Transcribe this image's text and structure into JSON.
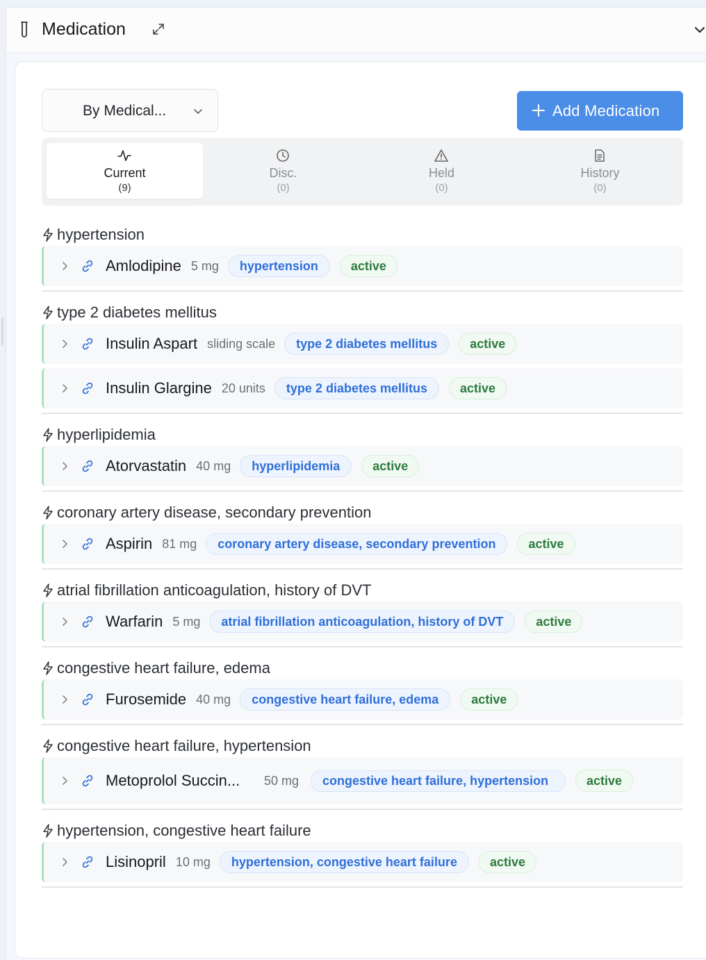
{
  "section": {
    "title": "Medication"
  },
  "filter": {
    "selected": "By Medical..."
  },
  "add_button": {
    "label": "Add Medication"
  },
  "tabs": [
    {
      "label": "Current",
      "count": "(9)",
      "icon": "activity-icon",
      "active": true
    },
    {
      "label": "Disc.",
      "count": "(0)",
      "icon": "clock-icon",
      "active": false
    },
    {
      "label": "Held",
      "count": "(0)",
      "icon": "warning-triangle-icon",
      "active": false
    },
    {
      "label": "History",
      "count": "(0)",
      "icon": "document-icon",
      "active": false
    }
  ],
  "groups": [
    {
      "condition": "hypertension",
      "meds": [
        {
          "name": "Amlodipine",
          "dose": "5 mg",
          "indication": "hypertension",
          "status": "active"
        }
      ]
    },
    {
      "condition": "type 2 diabetes mellitus",
      "meds": [
        {
          "name": "Insulin Aspart",
          "dose": "sliding scale",
          "indication": "type 2 diabetes mellitus",
          "status": "active"
        },
        {
          "name": "Insulin Glargine",
          "dose": "20 units",
          "indication": "type 2 diabetes mellitus",
          "status": "active"
        }
      ]
    },
    {
      "condition": "hyperlipidemia",
      "meds": [
        {
          "name": "Atorvastatin",
          "dose": "40 mg",
          "indication": "hyperlipidemia",
          "status": "active"
        }
      ]
    },
    {
      "condition": "coronary artery disease, secondary prevention",
      "meds": [
        {
          "name": "Aspirin",
          "dose": "81 mg",
          "indication": "coronary artery disease, secondary prevention",
          "status": "active"
        }
      ]
    },
    {
      "condition": "atrial fibrillation anticoagulation, history of DVT",
      "meds": [
        {
          "name": "Warfarin",
          "dose": "5 mg",
          "indication": "atrial fibrillation anticoagulation, history of DVT",
          "status": "active"
        }
      ]
    },
    {
      "condition": "congestive heart failure, edema",
      "meds": [
        {
          "name": "Furosemide",
          "dose": "40 mg",
          "indication": "congestive heart failure, edema",
          "status": "active"
        }
      ]
    },
    {
      "condition": "congestive heart failure, hypertension",
      "meds": [
        {
          "name": "Metoprolol Succin...",
          "dose": "50 mg",
          "indication": "congestive heart failure, hypertension",
          "status": "active"
        }
      ]
    },
    {
      "condition": "hypertension, congestive heart failure",
      "meds": [
        {
          "name": "Lisinopril",
          "dose": "10 mg",
          "indication": "hypertension, congestive heart failure",
          "status": "active"
        }
      ]
    }
  ],
  "colors": {
    "accent": "#4a8ee8",
    "indication_text": "#2f6fd8",
    "status_text": "#2d7a3e",
    "row_accent_border": "#a9e2b6"
  }
}
